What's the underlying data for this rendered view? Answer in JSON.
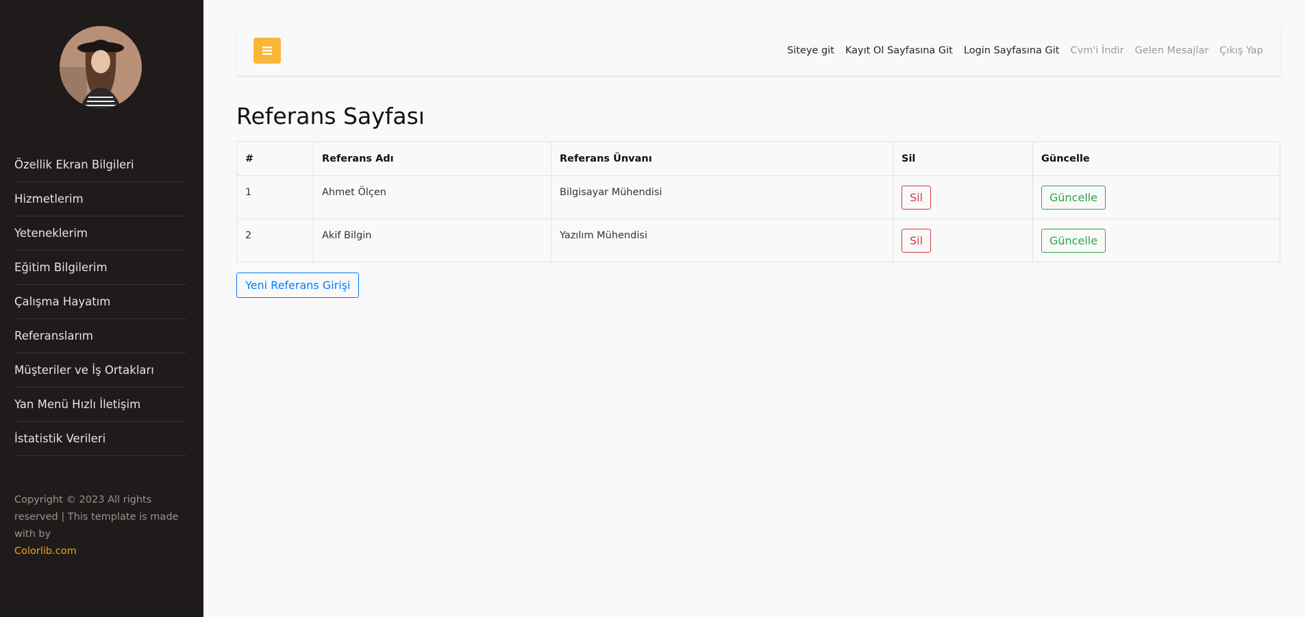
{
  "sidebar": {
    "items": [
      {
        "label": "Özellik Ekran Bilgileri"
      },
      {
        "label": "Hizmetlerim"
      },
      {
        "label": "Yeteneklerim"
      },
      {
        "label": "Eğitim Bilgilerim"
      },
      {
        "label": "Çalışma Hayatım"
      },
      {
        "label": "Referanslarım"
      },
      {
        "label": "Müşteriler ve İş Ortakları"
      },
      {
        "label": "Yan Menü Hızlı İletişim"
      },
      {
        "label": "İstatistik Verileri"
      }
    ],
    "footer": {
      "text": "Copyright © 2023 All rights reserved | This template is made with by",
      "link": "Colorlib.com"
    }
  },
  "navbar": {
    "toggle_icon": "hamburger-icon",
    "links": {
      "siteye_git": "Siteye git",
      "kayit_ol": "Kayıt Ol Sayfasına Git",
      "login": "Login Sayfasına Git",
      "cvm_indir": "Cvm'i İndir",
      "gelen_mesajlar": "Gelen Mesajlar",
      "cikis_yap": "Çıkış Yap"
    }
  },
  "main": {
    "title": "Referans Sayfası",
    "table": {
      "headers": [
        "#",
        "Referans Adı",
        "Referans Ünvanı",
        "Sil",
        "Güncelle"
      ],
      "rows": [
        {
          "id": "1",
          "name": "Ahmet Ölçen",
          "title": "Bilgisayar Mühendisi",
          "delete": "Sil",
          "update": "Güncelle"
        },
        {
          "id": "2",
          "name": "Akif Bilgin",
          "title": "Yazılım Mühendisi",
          "delete": "Sil",
          "update": "Güncelle"
        }
      ]
    },
    "new_button": "Yeni Referans Girişi"
  },
  "colors": {
    "sidebar_bg": "#1f1b1a",
    "accent": "#f8b739",
    "danger": "#dc3545",
    "success": "#28a745",
    "primary": "#007bff"
  }
}
